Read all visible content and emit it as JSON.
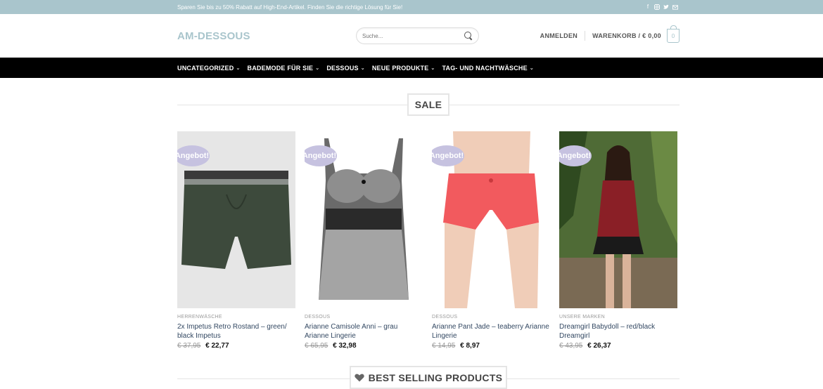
{
  "topbar": {
    "promo": "Sparen Sie bis zu 50% Rabatt auf High-End-Artikel. Finden Sie die richtige Lösung für Sie!",
    "social_icons": [
      "facebook-icon",
      "instagram-icon",
      "twitter-icon",
      "email-icon"
    ]
  },
  "header": {
    "logo": "AM-DESSOUS",
    "search_placeholder": "Suche...",
    "login": "ANMELDEN",
    "cart": "WARENKORB / € 0,00",
    "cart_count": "0"
  },
  "nav": {
    "items": [
      {
        "label": "UNCATEGORIZED"
      },
      {
        "label": "BADEMODE FÜR SIE"
      },
      {
        "label": "DESSOUS"
      },
      {
        "label": "NEUE PRODUKTE"
      },
      {
        "label": "TAG- UND NACHTWÄSCHE"
      }
    ]
  },
  "sale_section": {
    "title": "SALE"
  },
  "products": [
    {
      "badge": "Angebot!",
      "category": "HERRENWÄSCHE",
      "name": "2x Impetus Retro Rostand – green/ black Impetus",
      "old_price": "€ 37,95",
      "new_price": "€ 22,77"
    },
    {
      "badge": "Angebot!",
      "category": "DESSOUS",
      "name": "Arianne Camisole Anni – grau Arianne Lingerie",
      "old_price": "€ 65,95",
      "new_price": "€ 32,98"
    },
    {
      "badge": "Angebot!",
      "category": "DESSOUS",
      "name": "Arianne Pant Jade – teaberry Arianne Lingerie",
      "old_price": "€ 14,95",
      "new_price": "€ 8,97"
    },
    {
      "badge": "Angebot!",
      "category": "UNSERE MARKEN",
      "name": "Dreamgirl Babydoll – red/black Dreamgirl",
      "old_price": "€ 43,95",
      "new_price": "€ 26,37"
    }
  ],
  "best_selling": {
    "title": "BEST SELLING PRODUCTS"
  },
  "colors": {
    "accent": "#a9c5cc",
    "nav_bg": "#000000",
    "badge": "#c6c2e0",
    "link": "#334862"
  }
}
